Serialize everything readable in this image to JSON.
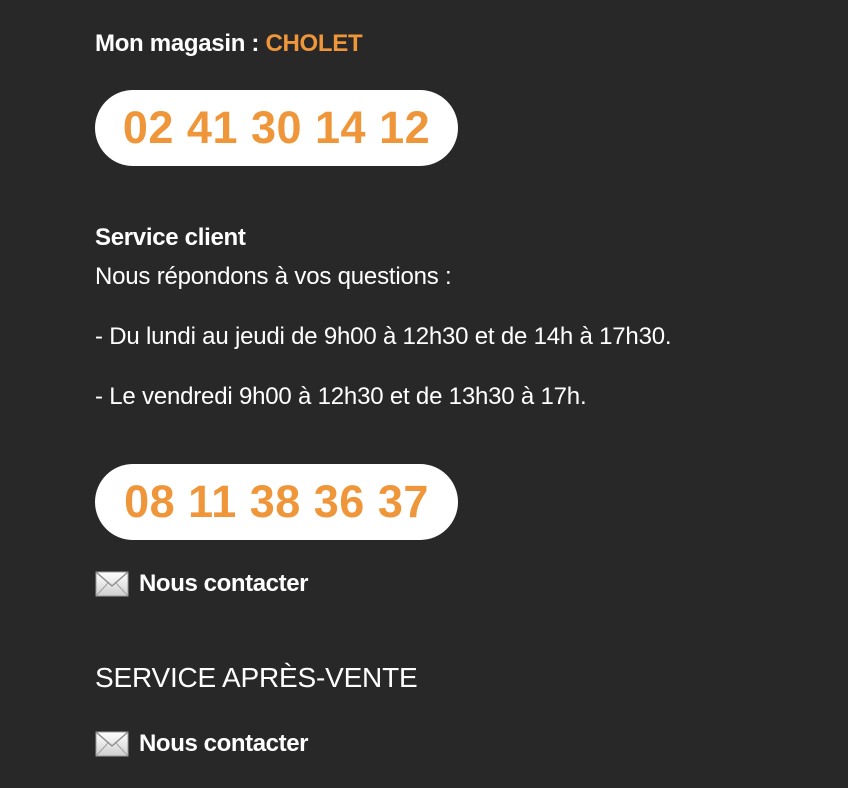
{
  "store": {
    "label": "Mon magasin : ",
    "name": "CHOLET",
    "phone": "02 41 30 14 12"
  },
  "service_client": {
    "title": "Service client",
    "intro": "Nous répondons à vos questions :",
    "hours": [
      "- Du lundi au jeudi de 9h00 à 12h30 et de 14h à 17h30.",
      "- Le vendredi 9h00 à 12h30 et de 13h30 à 17h."
    ],
    "phone": "08 11 38 36 37",
    "contact_label": "Nous contacter"
  },
  "after_sales": {
    "title": "SERVICE APRÈS-VENTE",
    "contact_label": "Nous contacter"
  },
  "colors": {
    "background": "#282828",
    "accent": "#f0963a",
    "text": "#ffffff"
  },
  "icons": {
    "contact": "envelope-icon"
  }
}
